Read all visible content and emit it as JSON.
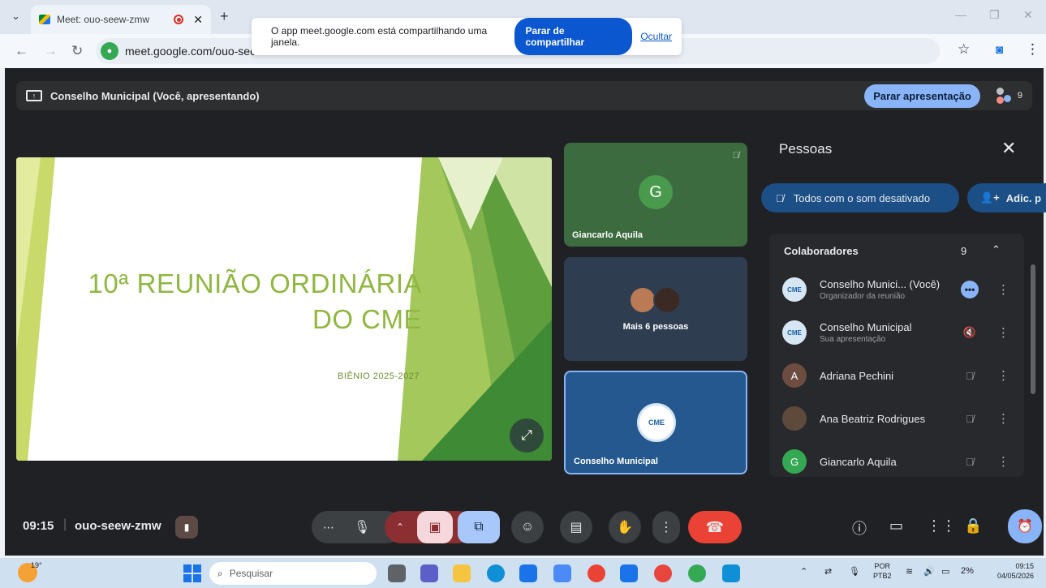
{
  "browser": {
    "tab_title": "Meet: ouo-seew-zmw",
    "url": "meet.google.com/ouo-seev",
    "share_message": "O app meet.google.com está compartilhando uma janela.",
    "stop_sharing_label": "Parar de compartilhar",
    "hide_label": "Ocultar"
  },
  "meet": {
    "presenting_title": "Conselho Municipal (Você, apresentando)",
    "stop_presenting_label": "Parar apresentação",
    "participant_count": "9",
    "slide": {
      "title_line1": "10ª REUNIÃO ORDINÁRIA",
      "title_line2": "DO CME",
      "subtitle": "BIÊNIO 2025-2027"
    },
    "tiles": [
      {
        "initial": "G",
        "name": "Giancarlo Aquila"
      },
      {
        "label": "Mais 6 pessoas"
      },
      {
        "logo_text": "CME",
        "name": "Conselho Municipal"
      }
    ],
    "people_panel": {
      "title": "Pessoas",
      "mute_all_label": "Todos com o som desativado",
      "add_label": "Adic. p",
      "section_title": "Colaboradores",
      "section_count": "9",
      "rows": [
        {
          "name": "Conselho Munici... (Você)",
          "sub": "Organizador da reunião"
        },
        {
          "name": "Conselho Municipal",
          "sub": "Sua apresentação"
        },
        {
          "initial": "A",
          "name": "Adriana Pechini"
        },
        {
          "name": "Ana Beatriz Rodrigues"
        },
        {
          "initial": "G",
          "name": "Giancarlo Aquila"
        }
      ]
    },
    "bottom": {
      "time": "09:15",
      "meeting_code": "ouo-seew-zmw"
    }
  },
  "taskbar": {
    "temperature": "19°",
    "search_placeholder": "Pesquisar",
    "lang_top": "POR",
    "lang_bottom": "PTB2",
    "battery": "2%",
    "time": "09:15",
    "date": "04/05/2026"
  },
  "colors": {
    "meet_bg": "#202124",
    "accent_blue": "#8ab4f8",
    "end_call_red": "#ea4335",
    "slide_green": "#8fb741"
  }
}
